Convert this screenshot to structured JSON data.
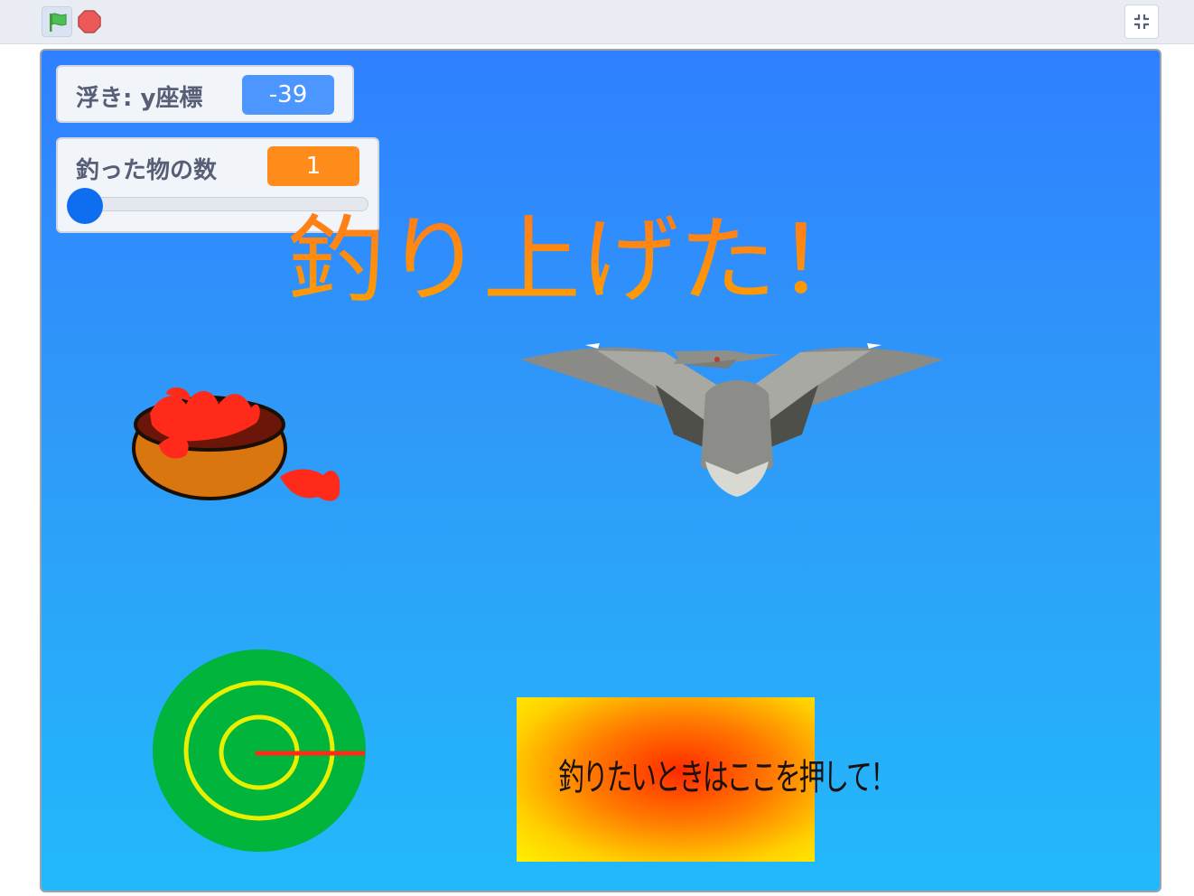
{
  "toolbar": {
    "green_flag_icon": "green-flag-icon",
    "stop_icon": "stop-sign-icon",
    "fullscreen_icon": "exit-fullscreen-icon"
  },
  "monitors": {
    "float_y": {
      "label": "浮き: y座標",
      "value": "-39"
    },
    "caught_count": {
      "label": "釣った物の数",
      "value": "1",
      "slider_fraction": 0.0
    }
  },
  "stage": {
    "headline": "釣り上げた！",
    "fish_button_label": "釣りたいときはここを押して！"
  },
  "colors": {
    "stage_top": "#2f80ff",
    "stage_bottom": "#22b9fb",
    "monitor_blue": "#4c97ff",
    "monitor_orange": "#ff8c1a",
    "target_green": "#00b43c",
    "target_ring": "#e6f000"
  }
}
